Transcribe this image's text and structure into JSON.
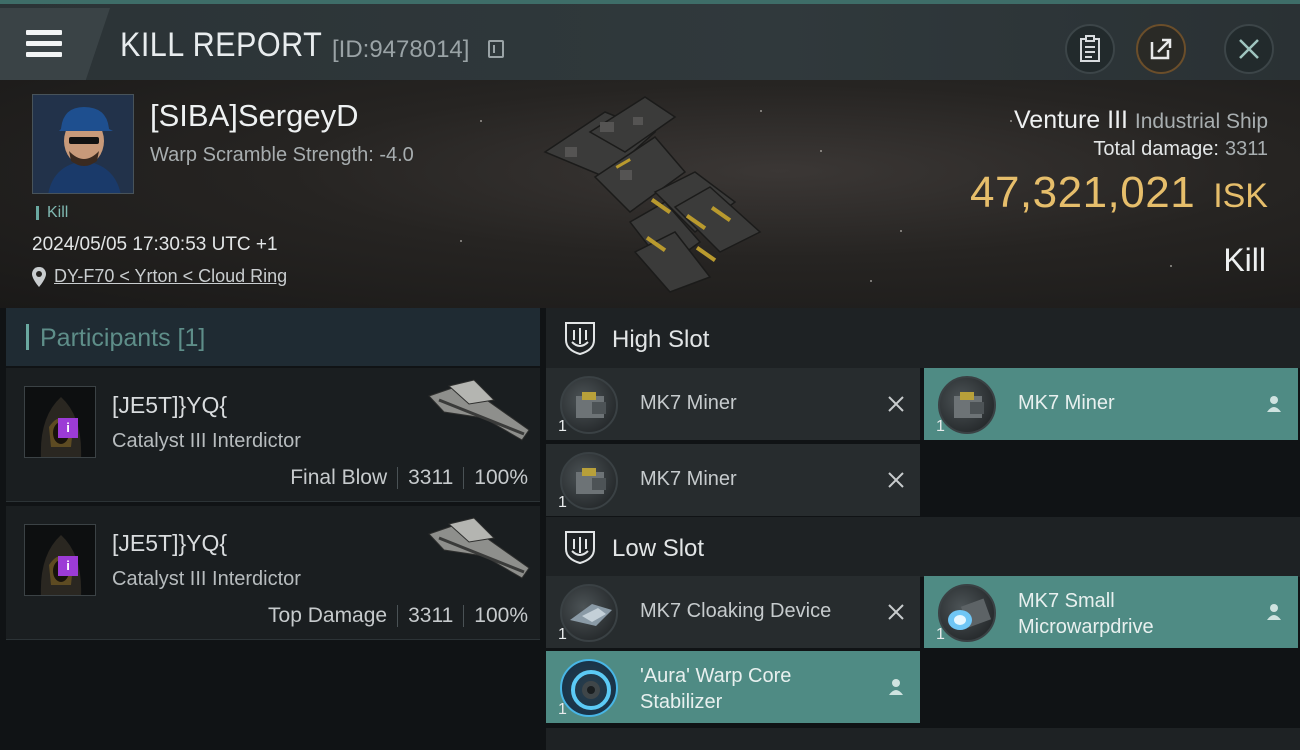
{
  "header": {
    "title": "KILL REPORT",
    "report_id": "[ID:9478014]",
    "icons": [
      "menu-icon",
      "copy-icon",
      "clipboard-icon",
      "share-icon",
      "close-icon"
    ]
  },
  "victim": {
    "name": "[SIBA]SergeyD",
    "stat": "Warp Scramble Strength: -4.0",
    "tag": "Kill",
    "datetime": "2024/05/05 17:30:53 UTC +1",
    "location": "DY-F70 < Yrton < Cloud Ring",
    "ship_name": "Venture III",
    "ship_class": "Industrial Ship",
    "damage_label": "Total damage:",
    "damage_value": "3311",
    "isk_amount": "47,321,021",
    "isk_unit": "ISK",
    "result": "Kill"
  },
  "participants": {
    "title": "Participants [1]",
    "cards": [
      {
        "name": "[JE5T]}YQ{",
        "ship": "Catalyst III Interdictor",
        "role": "Final Blow",
        "damage": "3311",
        "percent": "100%",
        "badge": "i"
      },
      {
        "name": "[JE5T]}YQ{",
        "ship": "Catalyst III Interdictor",
        "role": "Top Damage",
        "damage": "3311",
        "percent": "100%",
        "badge": "i"
      }
    ]
  },
  "slots": {
    "high": {
      "title": "High Slot",
      "modules": [
        {
          "name": "MK7 Miner",
          "qty": "1",
          "state": "destroyed"
        },
        {
          "name": "MK7 Miner",
          "qty": "1",
          "state": "dropped"
        },
        {
          "name": "MK7 Miner",
          "qty": "1",
          "state": "destroyed"
        }
      ]
    },
    "low": {
      "title": "Low Slot",
      "modules": [
        {
          "name": "MK7 Cloaking Device",
          "qty": "1",
          "state": "destroyed"
        },
        {
          "name": "MK7 Small\nMicrowarpdrive",
          "line1": "MK7 Small",
          "line2": "Microwarpdrive",
          "qty": "1",
          "state": "dropped"
        },
        {
          "name": "'Aura' Warp Core Stabilizer",
          "line1": "'Aura' Warp Core",
          "line2": "Stabilizer",
          "qty": "1",
          "state": "dropped"
        }
      ]
    }
  },
  "colors": {
    "accent": "#6aa9a1",
    "fitted": "#4f8b84",
    "isk": "#e6be6b",
    "badge": "#9c3bd6"
  }
}
